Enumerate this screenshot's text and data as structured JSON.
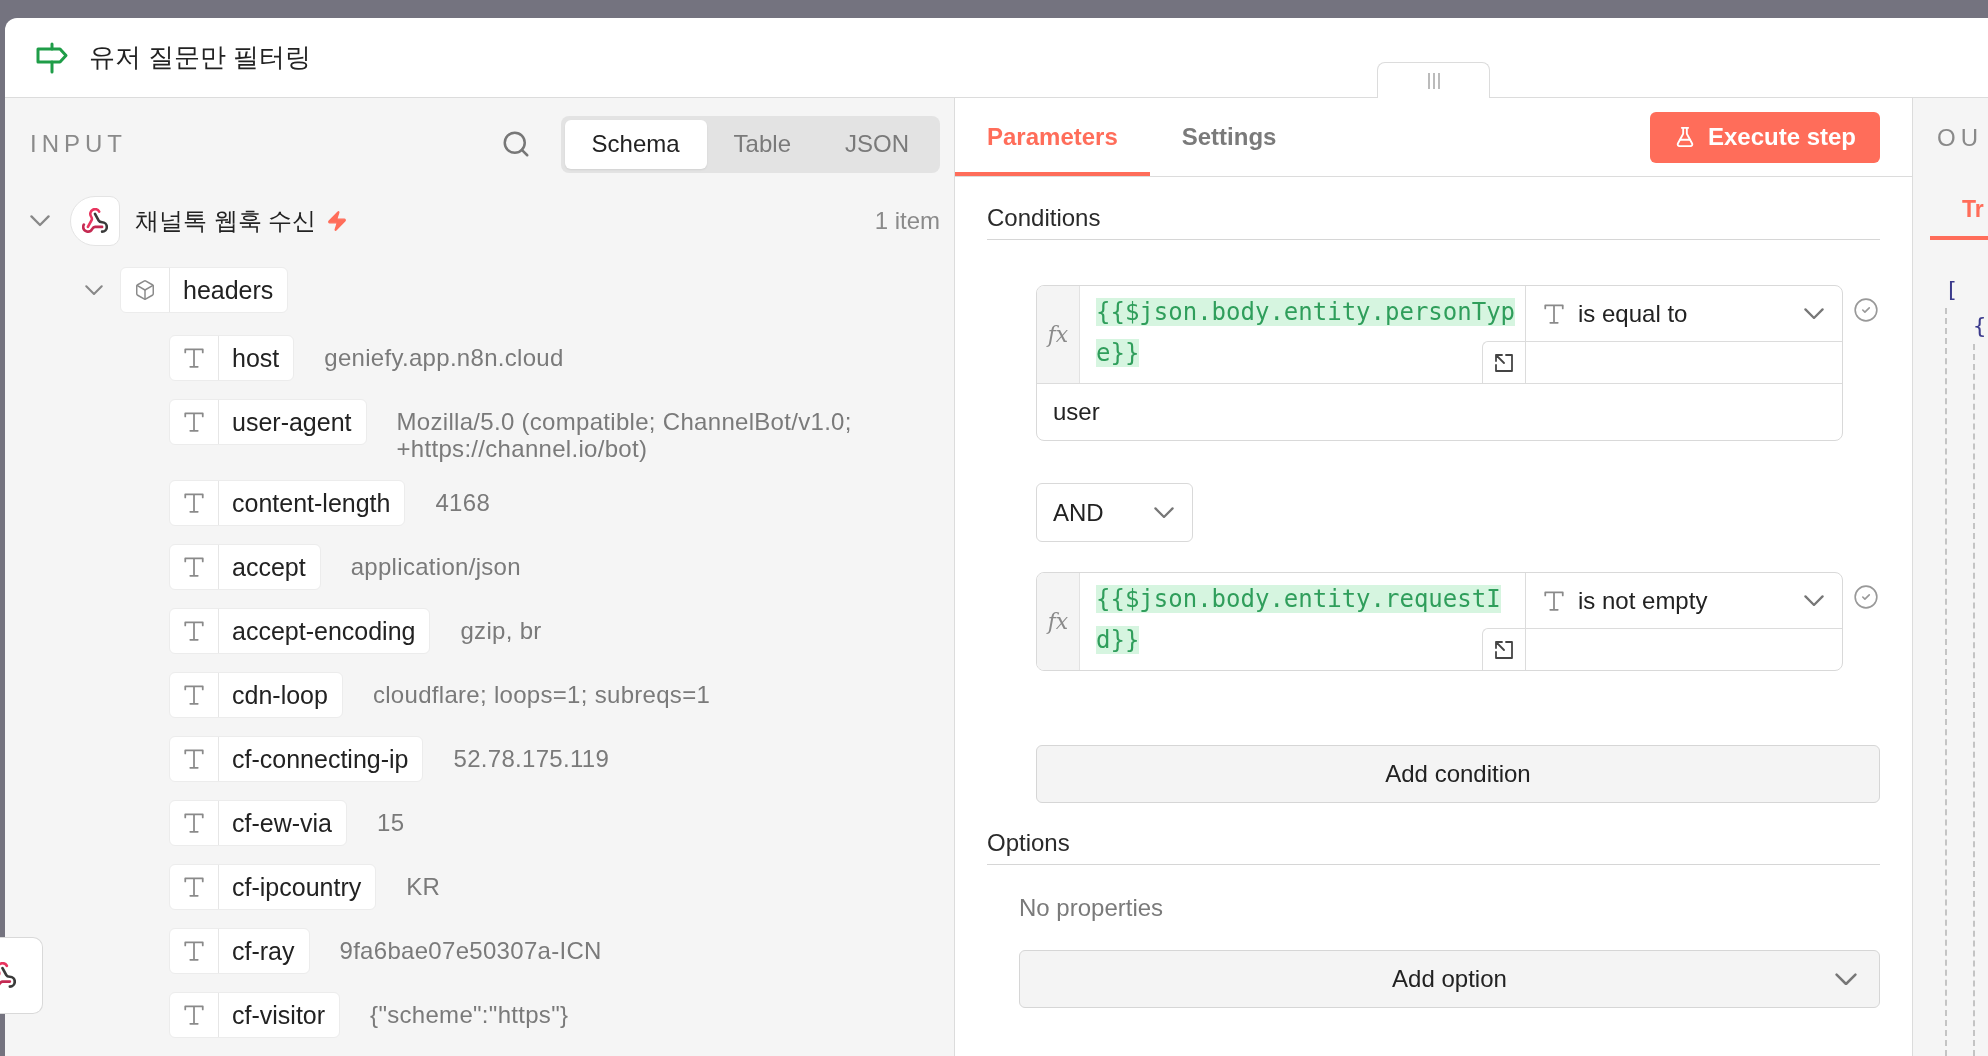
{
  "window": {
    "title": "유저 질문만 필터링"
  },
  "input_panel": {
    "title": "INPUT",
    "view_tabs": [
      {
        "label": "Schema",
        "selected": true
      },
      {
        "label": "Table",
        "selected": false
      },
      {
        "label": "JSON",
        "selected": false
      }
    ],
    "source": {
      "name": "채널톡 웹훅 수신",
      "trigger": true,
      "count": "1 item",
      "expanded": true
    },
    "tree": [
      {
        "key": "headers",
        "kind": "object",
        "expanded": true,
        "children": [
          {
            "key": "host",
            "kind": "string",
            "value": "geniefy.app.n8n.cloud"
          },
          {
            "key": "user-agent",
            "kind": "string",
            "value": "Mozilla/5.0 (compatible; ChannelBot/v1.0; +https://channel.io/bot)"
          },
          {
            "key": "content-length",
            "kind": "string",
            "value": "4168"
          },
          {
            "key": "accept",
            "kind": "string",
            "value": "application/json"
          },
          {
            "key": "accept-encoding",
            "kind": "string",
            "value": "gzip, br"
          },
          {
            "key": "cdn-loop",
            "kind": "string",
            "value": "cloudflare; loops=1; subreqs=1"
          },
          {
            "key": "cf-connecting-ip",
            "kind": "string",
            "value": "52.78.175.119"
          },
          {
            "key": "cf-ew-via",
            "kind": "string",
            "value": "15"
          },
          {
            "key": "cf-ipcountry",
            "kind": "string",
            "value": "KR"
          },
          {
            "key": "cf-ray",
            "kind": "string",
            "value": "9fa6bae07e50307a-ICN"
          },
          {
            "key": "cf-visitor",
            "kind": "string",
            "value": "{\"scheme\":\"https\"}"
          }
        ]
      }
    ]
  },
  "parameters_panel": {
    "tabs": [
      {
        "label": "Parameters",
        "selected": true
      },
      {
        "label": "Settings",
        "selected": false
      }
    ],
    "execute_button": "Execute step",
    "conditions": {
      "title": "Conditions",
      "items": [
        {
          "mode": "fx",
          "left": "{{$json.body.entity.personType}}",
          "operator": "is equal to",
          "right": "user"
        },
        {
          "mode": "fx",
          "left": "{{$json.body.entity.requestId}}",
          "operator": "is not empty"
        }
      ],
      "combinator": "AND",
      "add_button": "Add condition"
    },
    "options": {
      "title": "Options",
      "empty_text": "No properties",
      "add_button": "Add option"
    }
  },
  "output_panel": {
    "title": "OU",
    "tabs": [
      {
        "label": "Tr",
        "selected": true
      }
    ],
    "json_view": {
      "text": "[",
      "expanded": true,
      "children": [
        {
          "text": "{",
          "expanded": true
        }
      ]
    }
  }
}
